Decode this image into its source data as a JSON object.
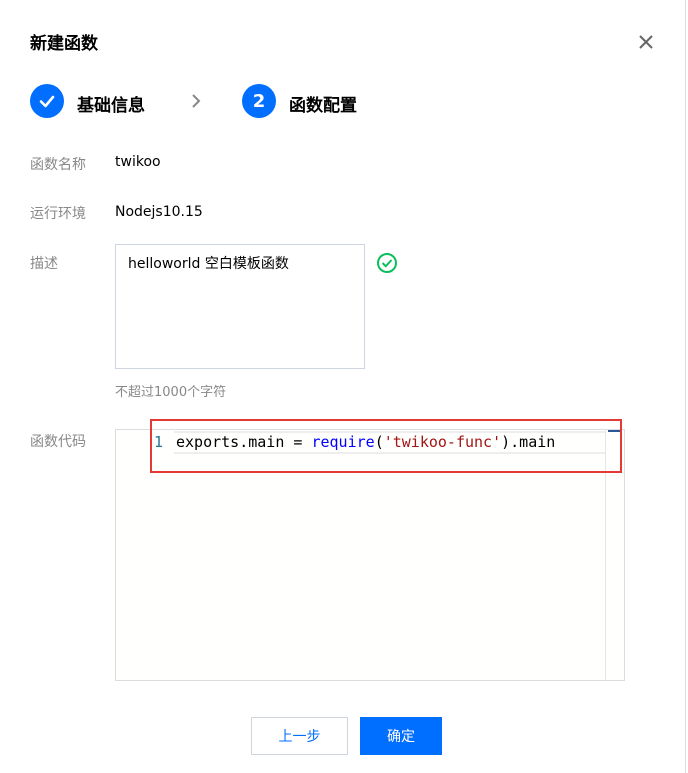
{
  "dialog": {
    "title": "新建函数"
  },
  "steps": [
    {
      "number": "",
      "label": "基础信息",
      "status": "done"
    },
    {
      "number": "2",
      "label": "函数配置",
      "status": "current"
    }
  ],
  "form": {
    "name": {
      "label": "函数名称",
      "value": "twikoo"
    },
    "runtime": {
      "label": "运行环境",
      "value": "Nodejs10.15"
    },
    "description": {
      "label": "描述",
      "value": "helloworld 空白模板函数",
      "hint": "不超过1000个字符"
    },
    "code": {
      "label": "函数代码",
      "line_number": "1",
      "tokens": {
        "part1": "exports.main = ",
        "fn": "require",
        "paren_open": "(",
        "str": "'twikoo-func'",
        "part2": ").main"
      }
    }
  },
  "buttons": {
    "prev": "上一步",
    "confirm": "确定"
  },
  "colors": {
    "primary": "#006eff",
    "success": "#0abf5b",
    "highlight": "#e53935"
  }
}
